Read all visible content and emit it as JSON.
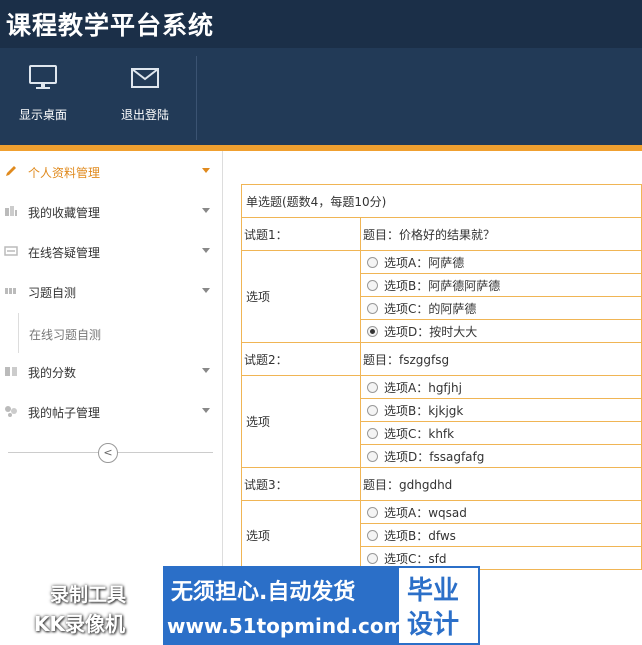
{
  "app": {
    "title": "课程教学平台系统"
  },
  "toolbar": {
    "desktop_label": "显示桌面",
    "logout_label": "退出登陆"
  },
  "sidebar": {
    "items": [
      {
        "label": "个人资料管理"
      },
      {
        "label": "我的收藏管理"
      },
      {
        "label": "在线答疑管理"
      },
      {
        "label": "习题自测"
      },
      {
        "label": "我的分数"
      },
      {
        "label": "我的帖子管理"
      }
    ],
    "sub_item": "在线习题自测",
    "collapse_glyph": "<"
  },
  "quiz": {
    "header": "单选题(题数4，每题10分)",
    "option_row_label": "选项",
    "questions": [
      {
        "no": "试题1：",
        "title": "题目：价格好的结果就？",
        "options": [
          "选项A：阿萨德",
          "选项B：阿萨德阿萨德",
          "选项C：的阿萨德",
          "选项D：按时大大"
        ]
      },
      {
        "no": "试题2：",
        "title": "题目：fszggfsg",
        "options": [
          "选项A：hgfjhj",
          "选项B：kjkjgk",
          "选项C：khfk",
          "选项D：fssagfafg"
        ]
      },
      {
        "no": "试题3：",
        "title": "题目：gdhgdhd",
        "options": [
          "选项A：wqsad",
          "选项B：dfws",
          "选项C：sfd"
        ]
      }
    ]
  },
  "overlays": {
    "recorder_line1": "录制工具",
    "recorder_line2": "KK录像机",
    "banner_line1": "无须担心.自动发货",
    "banner_line2": "www.51topmind.com",
    "badge_line1": "毕业",
    "badge_line2": "设计"
  },
  "colors": {
    "header_bg": "#1f3551",
    "accent_orange": "#f0a030",
    "table_border": "#f0b555",
    "banner_blue": "#2b6fc8"
  }
}
